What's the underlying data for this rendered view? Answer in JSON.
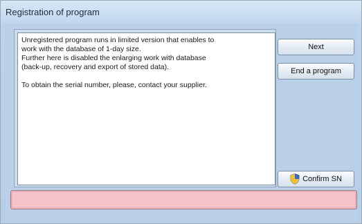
{
  "window": {
    "title": "Registration of program"
  },
  "info": {
    "lines": [
      "Unregistered program runs in limited version that enables to",
      "work with the database of 1-day size.",
      "Further here is disabled the enlarging work with database",
      "(back-up, recovery and export of stored data).",
      "",
      "To obtain the serial number, please,  contact your supplier."
    ]
  },
  "buttons": {
    "next": "Next",
    "end_program": "End a program",
    "confirm_sn": "Confirm SN"
  },
  "status": {
    "text": ""
  },
  "icons": {
    "confirm": "shield-icon"
  }
}
